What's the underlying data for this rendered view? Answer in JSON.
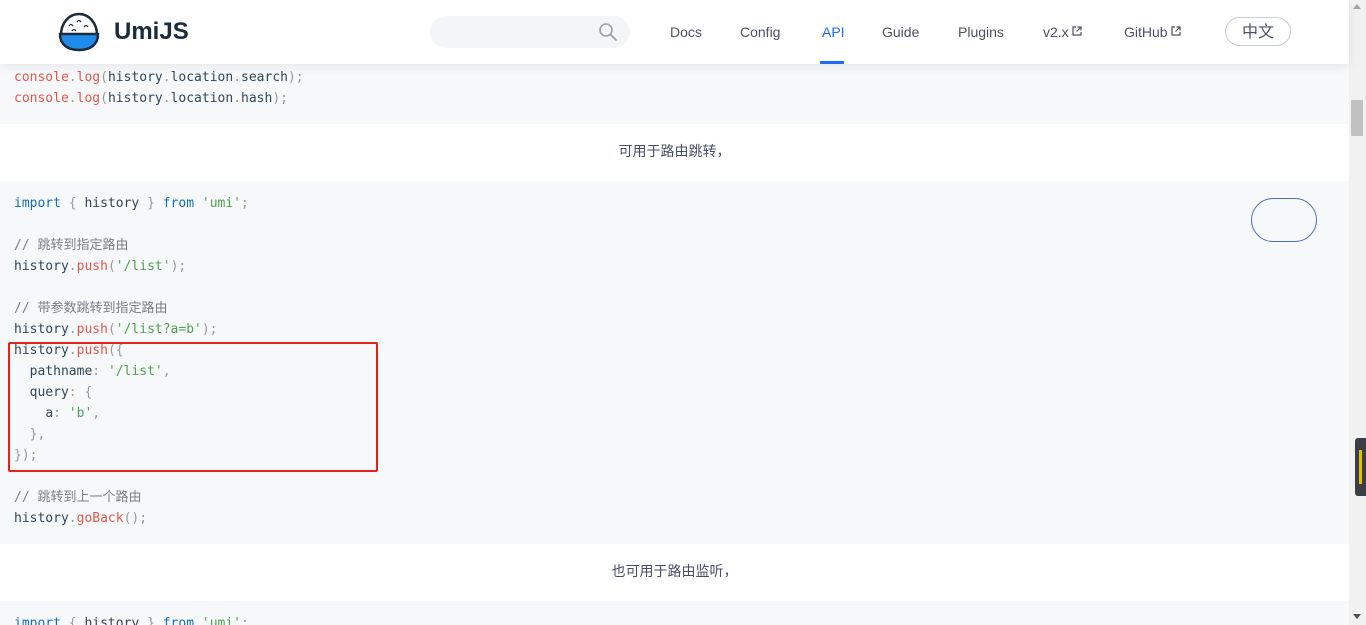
{
  "header": {
    "brand": "UmiJS",
    "search": {
      "placeholder": "",
      "icon": "search-icon"
    },
    "nav": [
      {
        "label": "Docs"
      },
      {
        "label": "Config"
      },
      {
        "label": "API",
        "active": true
      },
      {
        "label": "Guide"
      },
      {
        "label": "Plugins"
      },
      {
        "label": "v2.x",
        "external": true
      },
      {
        "label": "GitHub",
        "external": true
      }
    ],
    "lang": "中文",
    "accent": "#1f6bf5"
  },
  "code_top": {
    "lines": [
      "console.log(history.location.search);",
      "console.log(history.location.hash);"
    ]
  },
  "section1": {
    "text": "可用于路由跳转，"
  },
  "code_main": {
    "lines": [
      "import { history } from 'umi';",
      "",
      "// 跳转到指定路由",
      "history.push('/list');",
      "",
      "// 带参数跳转到指定路由",
      "history.push('/list?a=b');",
      "history.push({",
      "  pathname: '/list',",
      "  query: {",
      "    a: 'b',",
      "  },",
      "});",
      "",
      "// 跳转到上一个路由",
      "history.goBack();"
    ],
    "highlight_color": "#e5211b"
  },
  "section2": {
    "text": "也可用于路由监听，"
  },
  "code_bottom": {
    "lines": [
      "import { history } from 'umi';"
    ]
  }
}
